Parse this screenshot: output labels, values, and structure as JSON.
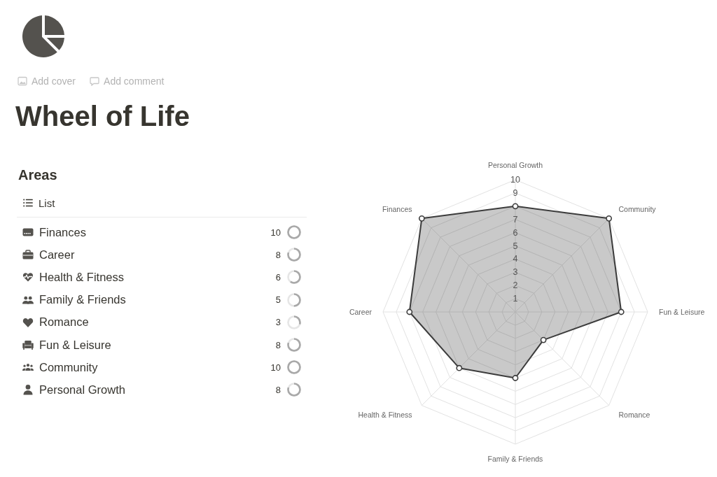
{
  "page": {
    "add_cover": "Add cover",
    "add_comment": "Add comment",
    "title": "Wheel of Life"
  },
  "areas": {
    "heading": "Areas",
    "view_tab": "List",
    "items": [
      {
        "name": "Finances",
        "score": "10",
        "level": 1.0
      },
      {
        "name": "Career",
        "score": "8",
        "level": 0.8
      },
      {
        "name": "Health & Fitness",
        "score": "6",
        "level": 0.6
      },
      {
        "name": "Family & Friends",
        "score": "5",
        "level": 0.5
      },
      {
        "name": "Romance",
        "score": "3",
        "level": 0.3
      },
      {
        "name": "Fun & Leisure",
        "score": "8",
        "level": 0.8
      },
      {
        "name": "Community",
        "score": "10",
        "level": 1.0
      },
      {
        "name": "Personal Growth",
        "score": "8",
        "level": 0.8
      }
    ]
  },
  "chart": {
    "chart_data": {
      "type": "radar",
      "categories": [
        "Personal Growth",
        "Community",
        "Fun & Leisure",
        "Romance",
        "Family & Friends",
        "Health & Fitness",
        "Career",
        "Finances"
      ],
      "values": [
        8,
        10,
        8,
        3,
        5,
        6,
        8,
        10
      ],
      "color": "#3c3c3c",
      "ylim": [
        0,
        10
      ],
      "yticks": [
        1,
        2,
        3,
        4,
        5,
        6,
        7,
        9,
        10
      ],
      "marker": "circle"
    }
  }
}
